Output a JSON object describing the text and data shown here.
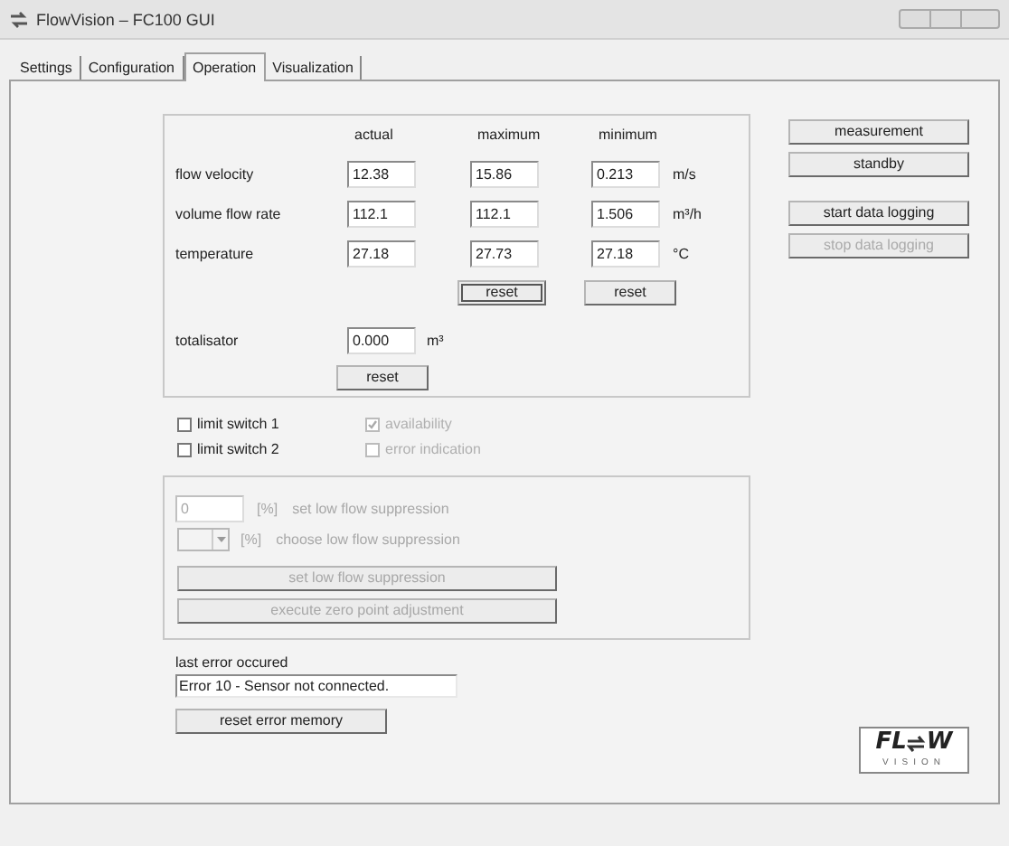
{
  "window": {
    "title": "FlowVision – FC100 GUI"
  },
  "tabs": [
    {
      "label": "Settings",
      "selected": false
    },
    {
      "label": "Configuration",
      "selected": false
    },
    {
      "label": "Operation",
      "selected": true
    },
    {
      "label": "Visualization",
      "selected": false
    }
  ],
  "measurements": {
    "columns": [
      "actual",
      "maximum",
      "minimum"
    ],
    "rows": [
      {
        "label": "flow velocity",
        "values": [
          "12.38",
          "15.86",
          "0.213"
        ],
        "unit": "m/s"
      },
      {
        "label": "volume flow rate",
        "values": [
          "112.1",
          "112.1",
          "1.506"
        ],
        "unit": "m³/h"
      },
      {
        "label": "temperature",
        "values": [
          "27.18",
          "27.73",
          "27.18"
        ],
        "unit": "°C"
      }
    ],
    "reset_buttons": [
      {
        "label": "reset",
        "focused": true
      },
      {
        "label": "reset",
        "focused": false
      }
    ],
    "totalisator": {
      "label": "totalisator",
      "value": "0.000",
      "unit": "m³",
      "reset_button": "reset"
    }
  },
  "switches": [
    {
      "label": "limit switch 1",
      "checked": false,
      "disabled": false
    },
    {
      "label": "availability",
      "checked": true,
      "disabled": true
    },
    {
      "label": "limit switch 2",
      "checked": false,
      "disabled": false
    },
    {
      "label": "error indication",
      "checked": false,
      "disabled": true
    }
  ],
  "low_flow": {
    "disabled": true,
    "value": "0",
    "value_unit": "[%]",
    "value_label": "set low flow suppression",
    "choice_unit": "[%]",
    "choice_label": "choose low flow suppression",
    "buttons": [
      "set low flow suppression",
      "execute zero point adjustment"
    ]
  },
  "error": {
    "label": "last error occured",
    "value": "Error 10 - Sensor not connected.",
    "button": "reset error memory"
  },
  "action_groups": [
    [
      {
        "label": "measurement",
        "disabled": false
      },
      {
        "label": "standby",
        "disabled": false
      }
    ],
    [
      {
        "label": "start data logging",
        "disabled": false
      },
      {
        "label": "stop data logging",
        "disabled": true
      }
    ]
  ],
  "logo": {
    "left": "FL",
    "right": "W",
    "subtitle": "VISION"
  }
}
